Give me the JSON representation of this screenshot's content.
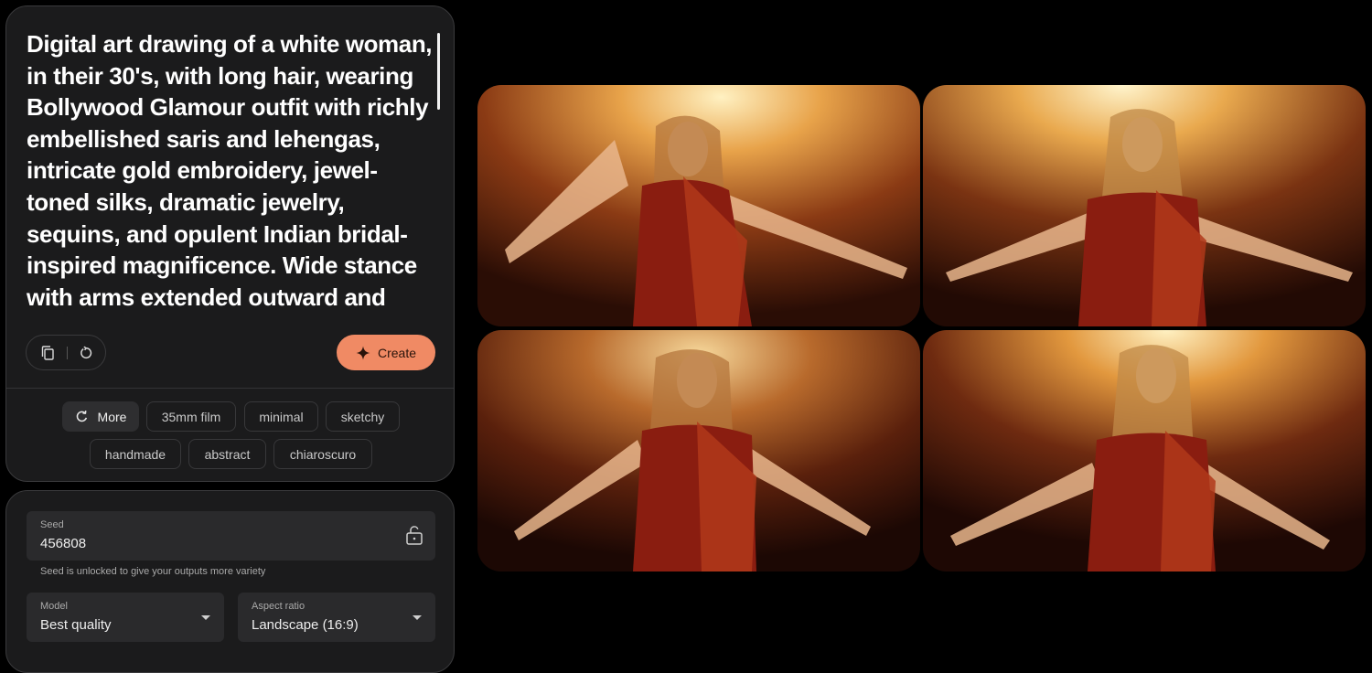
{
  "prompt": {
    "lines": [
      "Digital art drawing of a white woman,",
      "in their 30's, with long hair, wearing",
      "Bollywood Glamour outfit with richly",
      "embellished saris and lehengas,",
      "intricate gold embroidery, jewel-",
      "toned silks, dramatic jewelry,",
      "sequins, and opulent Indian bridal-",
      "inspired magnificence. Wide stance",
      "with arms extended outward and"
    ]
  },
  "actions": {
    "copy_icon": "copy-icon",
    "reset_icon": "reset-icon",
    "create_label": "Create",
    "create_icon": "sparkle-icon"
  },
  "style_chips": {
    "more_label": "More",
    "more_icon": "refresh-icon",
    "items": [
      "35mm film",
      "minimal",
      "sketchy",
      "handmade",
      "abstract",
      "chiaroscuro"
    ]
  },
  "settings": {
    "seed_label": "Seed",
    "seed_value": "456808",
    "seed_lock_icon": "unlock-icon",
    "seed_hint": "Seed is unlocked to give your outputs more variety",
    "model_label": "Model",
    "model_value": "Best quality",
    "aspect_label": "Aspect ratio",
    "aspect_value": "Landscape (16:9)"
  },
  "colors": {
    "accent": "#f08a64",
    "panel": "#1b1b1c",
    "background": "#000000"
  },
  "gallery": {
    "images": [
      "generated-image-1",
      "generated-image-2",
      "generated-image-3",
      "generated-image-4"
    ]
  }
}
